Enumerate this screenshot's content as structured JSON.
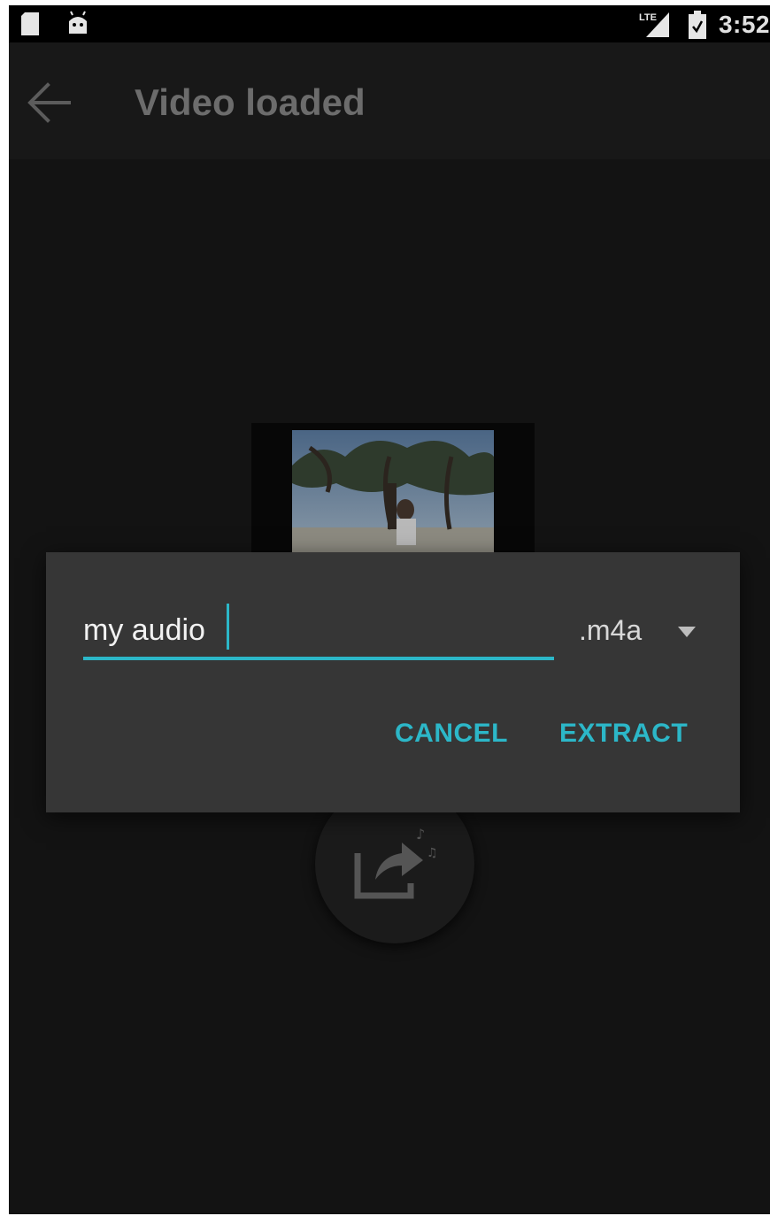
{
  "status_bar": {
    "time": "3:52",
    "icons": [
      "sd-card-icon",
      "android-icon",
      "lte-signal-icon",
      "battery-icon"
    ]
  },
  "app_bar": {
    "title": "Video loaded",
    "back_icon": "arrow-back-icon"
  },
  "dialog": {
    "filename_value": "my audio",
    "extension": ".m4a",
    "cancel_label": "CANCEL",
    "extract_label": "EXTRACT"
  },
  "fab": {
    "icon": "extract-audio-icon"
  },
  "colors": {
    "accent": "#2cb7c8",
    "background": "#131313",
    "dialog": "#363636",
    "title": "#6c6c6c"
  }
}
